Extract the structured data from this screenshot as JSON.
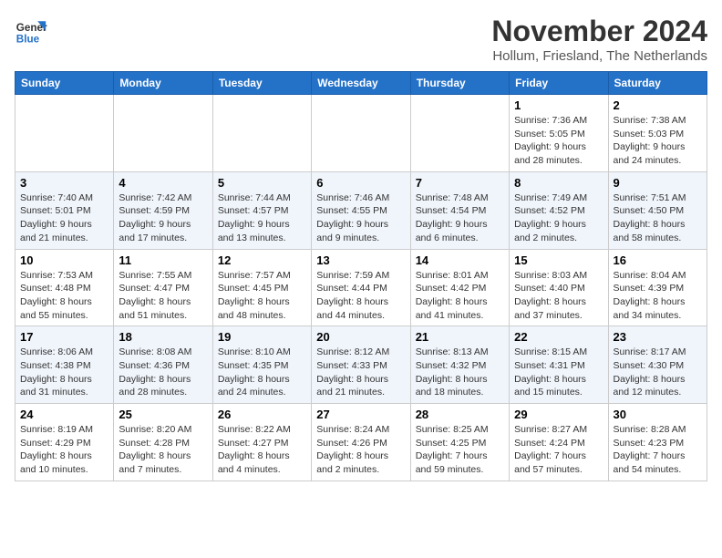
{
  "logo": {
    "line1": "General",
    "line2": "Blue"
  },
  "title": "November 2024",
  "location": "Hollum, Friesland, The Netherlands",
  "weekdays": [
    "Sunday",
    "Monday",
    "Tuesday",
    "Wednesday",
    "Thursday",
    "Friday",
    "Saturday"
  ],
  "weeks": [
    [
      {
        "day": "",
        "info": ""
      },
      {
        "day": "",
        "info": ""
      },
      {
        "day": "",
        "info": ""
      },
      {
        "day": "",
        "info": ""
      },
      {
        "day": "",
        "info": ""
      },
      {
        "day": "1",
        "info": "Sunrise: 7:36 AM\nSunset: 5:05 PM\nDaylight: 9 hours and 28 minutes."
      },
      {
        "day": "2",
        "info": "Sunrise: 7:38 AM\nSunset: 5:03 PM\nDaylight: 9 hours and 24 minutes."
      }
    ],
    [
      {
        "day": "3",
        "info": "Sunrise: 7:40 AM\nSunset: 5:01 PM\nDaylight: 9 hours and 21 minutes."
      },
      {
        "day": "4",
        "info": "Sunrise: 7:42 AM\nSunset: 4:59 PM\nDaylight: 9 hours and 17 minutes."
      },
      {
        "day": "5",
        "info": "Sunrise: 7:44 AM\nSunset: 4:57 PM\nDaylight: 9 hours and 13 minutes."
      },
      {
        "day": "6",
        "info": "Sunrise: 7:46 AM\nSunset: 4:55 PM\nDaylight: 9 hours and 9 minutes."
      },
      {
        "day": "7",
        "info": "Sunrise: 7:48 AM\nSunset: 4:54 PM\nDaylight: 9 hours and 6 minutes."
      },
      {
        "day": "8",
        "info": "Sunrise: 7:49 AM\nSunset: 4:52 PM\nDaylight: 9 hours and 2 minutes."
      },
      {
        "day": "9",
        "info": "Sunrise: 7:51 AM\nSunset: 4:50 PM\nDaylight: 8 hours and 58 minutes."
      }
    ],
    [
      {
        "day": "10",
        "info": "Sunrise: 7:53 AM\nSunset: 4:48 PM\nDaylight: 8 hours and 55 minutes."
      },
      {
        "day": "11",
        "info": "Sunrise: 7:55 AM\nSunset: 4:47 PM\nDaylight: 8 hours and 51 minutes."
      },
      {
        "day": "12",
        "info": "Sunrise: 7:57 AM\nSunset: 4:45 PM\nDaylight: 8 hours and 48 minutes."
      },
      {
        "day": "13",
        "info": "Sunrise: 7:59 AM\nSunset: 4:44 PM\nDaylight: 8 hours and 44 minutes."
      },
      {
        "day": "14",
        "info": "Sunrise: 8:01 AM\nSunset: 4:42 PM\nDaylight: 8 hours and 41 minutes."
      },
      {
        "day": "15",
        "info": "Sunrise: 8:03 AM\nSunset: 4:40 PM\nDaylight: 8 hours and 37 minutes."
      },
      {
        "day": "16",
        "info": "Sunrise: 8:04 AM\nSunset: 4:39 PM\nDaylight: 8 hours and 34 minutes."
      }
    ],
    [
      {
        "day": "17",
        "info": "Sunrise: 8:06 AM\nSunset: 4:38 PM\nDaylight: 8 hours and 31 minutes."
      },
      {
        "day": "18",
        "info": "Sunrise: 8:08 AM\nSunset: 4:36 PM\nDaylight: 8 hours and 28 minutes."
      },
      {
        "day": "19",
        "info": "Sunrise: 8:10 AM\nSunset: 4:35 PM\nDaylight: 8 hours and 24 minutes."
      },
      {
        "day": "20",
        "info": "Sunrise: 8:12 AM\nSunset: 4:33 PM\nDaylight: 8 hours and 21 minutes."
      },
      {
        "day": "21",
        "info": "Sunrise: 8:13 AM\nSunset: 4:32 PM\nDaylight: 8 hours and 18 minutes."
      },
      {
        "day": "22",
        "info": "Sunrise: 8:15 AM\nSunset: 4:31 PM\nDaylight: 8 hours and 15 minutes."
      },
      {
        "day": "23",
        "info": "Sunrise: 8:17 AM\nSunset: 4:30 PM\nDaylight: 8 hours and 12 minutes."
      }
    ],
    [
      {
        "day": "24",
        "info": "Sunrise: 8:19 AM\nSunset: 4:29 PM\nDaylight: 8 hours and 10 minutes."
      },
      {
        "day": "25",
        "info": "Sunrise: 8:20 AM\nSunset: 4:28 PM\nDaylight: 8 hours and 7 minutes."
      },
      {
        "day": "26",
        "info": "Sunrise: 8:22 AM\nSunset: 4:27 PM\nDaylight: 8 hours and 4 minutes."
      },
      {
        "day": "27",
        "info": "Sunrise: 8:24 AM\nSunset: 4:26 PM\nDaylight: 8 hours and 2 minutes."
      },
      {
        "day": "28",
        "info": "Sunrise: 8:25 AM\nSunset: 4:25 PM\nDaylight: 7 hours and 59 minutes."
      },
      {
        "day": "29",
        "info": "Sunrise: 8:27 AM\nSunset: 4:24 PM\nDaylight: 7 hours and 57 minutes."
      },
      {
        "day": "30",
        "info": "Sunrise: 8:28 AM\nSunset: 4:23 PM\nDaylight: 7 hours and 54 minutes."
      }
    ]
  ]
}
